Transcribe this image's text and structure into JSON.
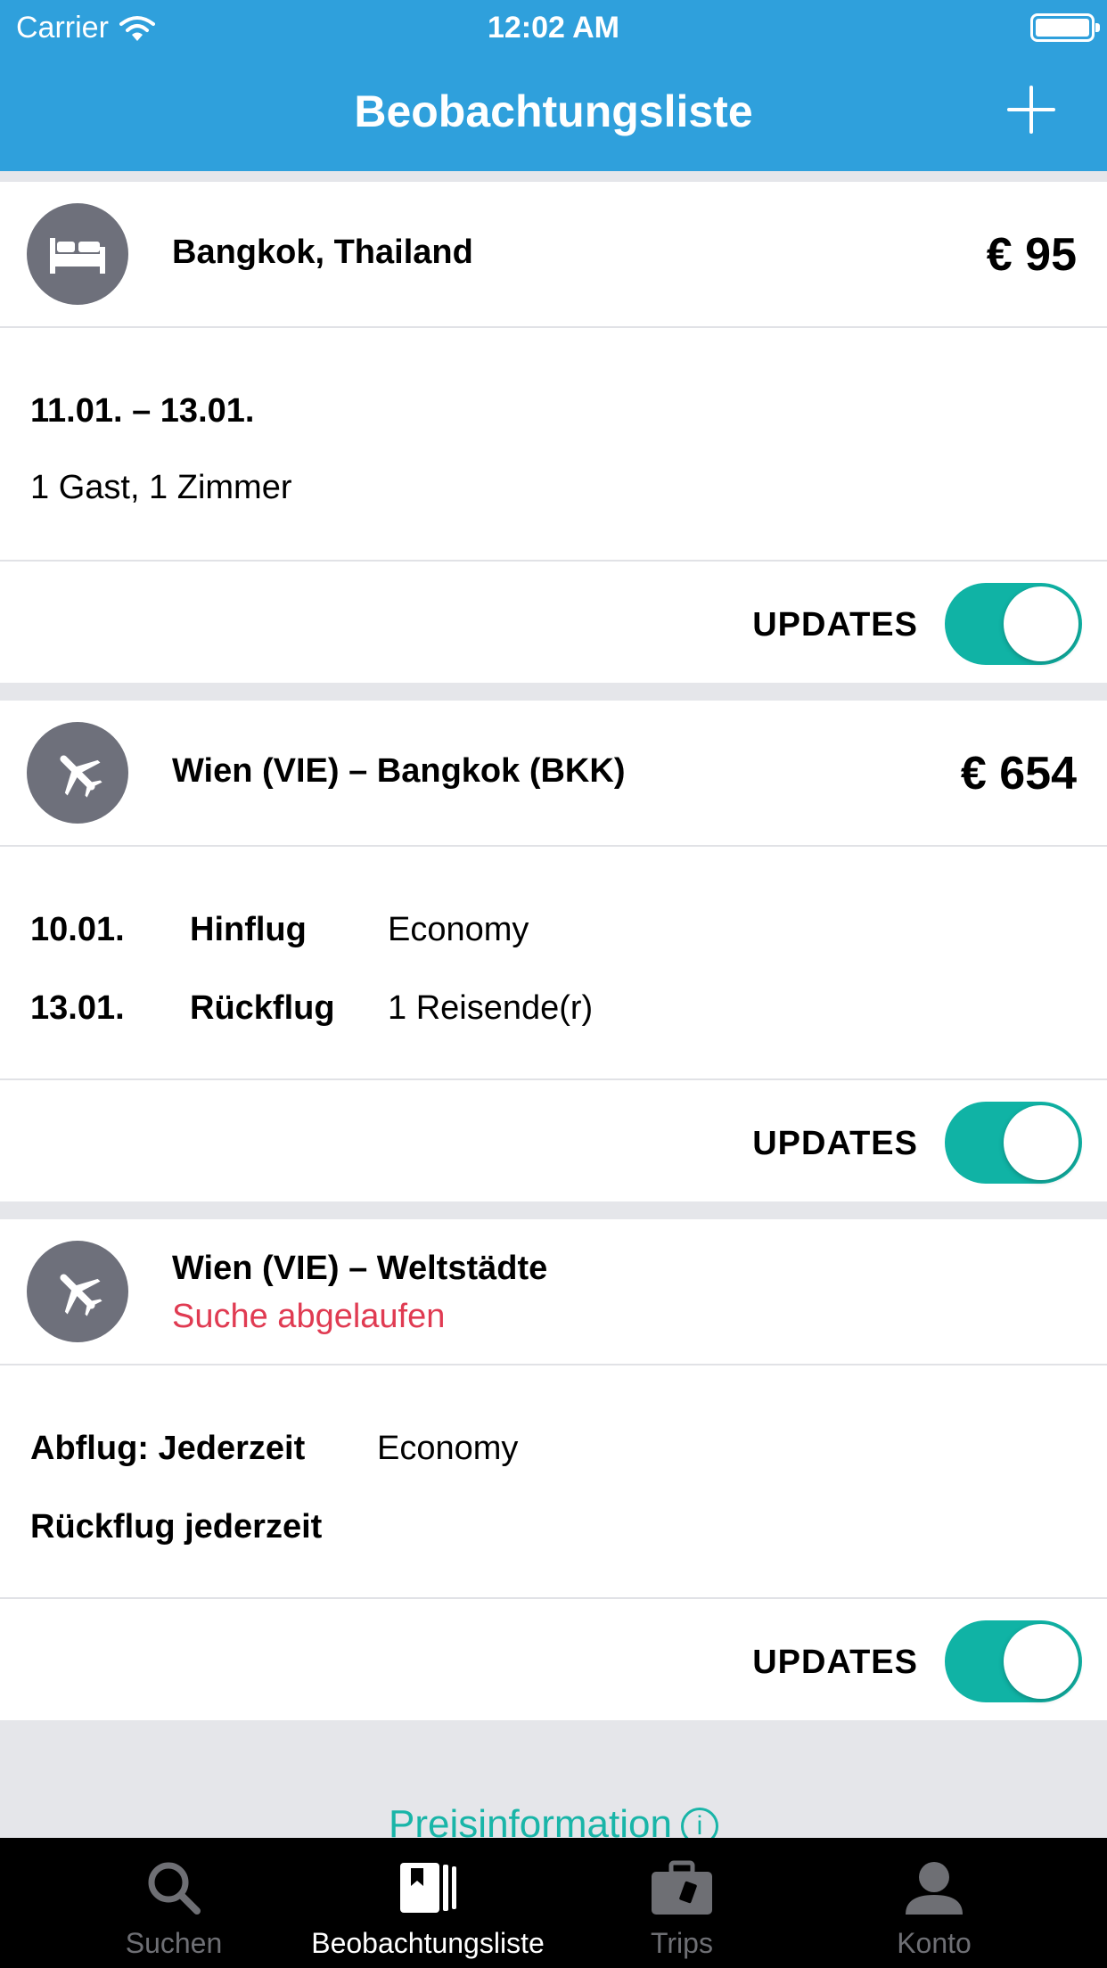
{
  "status_bar": {
    "carrier": "Carrier",
    "time": "12:02 AM"
  },
  "header": {
    "title": "Beobachtungsliste",
    "add_icon": "plus-icon"
  },
  "colors": {
    "header": "#2fa0dc",
    "toggle_on": "#10b3a5",
    "expired": "#e03b52",
    "link": "#19b5a8"
  },
  "cards": [
    {
      "icon": "bed-icon",
      "title": "Bangkok, Thailand",
      "price": "€ 95",
      "dates": "11.01. – 13.01.",
      "guests": "1 Gast, 1 Zimmer",
      "updates_label": "UPDATES",
      "updates_on": true
    },
    {
      "icon": "airplane-icon",
      "title": "Wien (VIE) – Bangkok (BKK)",
      "price": "€ 654",
      "outbound_date": "10.01.",
      "outbound_label": "Hinflug",
      "cabin": "Economy",
      "return_date": "13.01.",
      "return_label": "Rückflug",
      "travelers": "1 Reisende(r)",
      "updates_label": "UPDATES",
      "updates_on": true
    },
    {
      "icon": "airplane-icon",
      "title": "Wien (VIE) – Weltstädte",
      "status": "Suche abgelaufen",
      "departure": "Abflug: Jederzeit",
      "cabin": "Economy",
      "return": "Rückflug jederzeit",
      "updates_label": "UPDATES",
      "updates_on": true
    }
  ],
  "price_info": {
    "label": "Preisinformation",
    "icon": "i"
  },
  "tabbar": [
    {
      "label": "Suchen",
      "icon": "search-icon",
      "active": false
    },
    {
      "label": "Beobachtungsliste",
      "icon": "watchlist-icon",
      "active": true
    },
    {
      "label": "Trips",
      "icon": "suitcase-icon",
      "active": false
    },
    {
      "label": "Konto",
      "icon": "person-icon",
      "active": false
    }
  ]
}
